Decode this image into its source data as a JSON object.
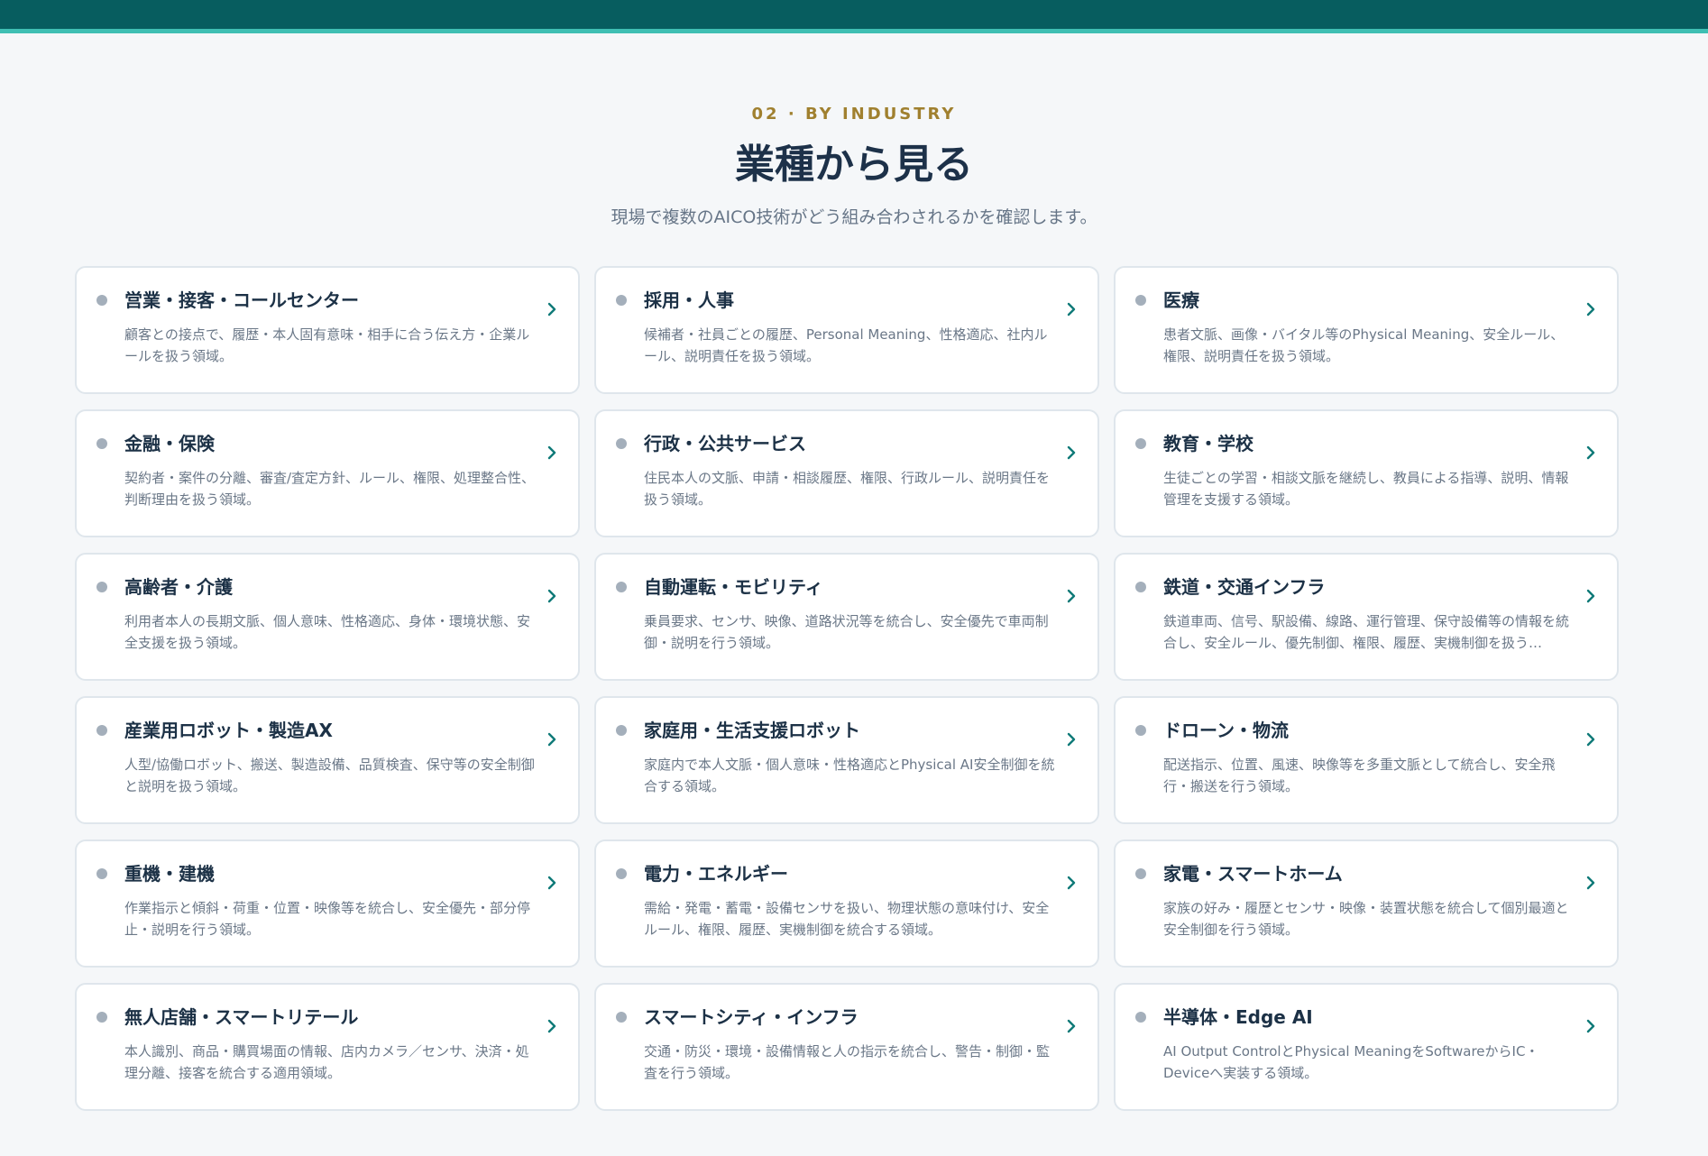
{
  "section": {
    "eyebrow": "02 · BY INDUSTRY",
    "title": "業種から見る",
    "subtitle": "現場で複数のAICO技術がどう組み合わされるかを確認します。"
  },
  "colors": {
    "topbar": "#075d5f",
    "topbar_accent": "#3fbfb3",
    "eyebrow": "#a0802f",
    "chevron": "#0f7a78"
  },
  "cards": [
    {
      "title": "営業・接客・コールセンター",
      "desc": "顧客との接点で、履歴・本人固有意味・相手に合う伝え方・企業ルールを扱う領域。",
      "icon": "chevron-right-icon"
    },
    {
      "title": "採用・人事",
      "desc": "候補者・社員ごとの履歴、Personal Meaning、性格適応、社内ルール、説明責任を扱う領域。",
      "icon": "chevron-right-icon"
    },
    {
      "title": "医療",
      "desc": "患者文脈、画像・バイタル等のPhysical Meaning、安全ルール、権限、説明責任を扱う領域。",
      "icon": "chevron-right-icon"
    },
    {
      "title": "金融・保険",
      "desc": "契約者・案件の分離、審査/査定方針、ルール、権限、処理整合性、判断理由を扱う領域。",
      "icon": "chevron-right-icon"
    },
    {
      "title": "行政・公共サービス",
      "desc": "住民本人の文脈、申請・相談履歴、権限、行政ルール、説明責任を扱う領域。",
      "icon": "chevron-right-icon"
    },
    {
      "title": "教育・学校",
      "desc": "生徒ごとの学習・相談文脈を継続し、教員による指導、説明、情報管理を支援する領域。",
      "icon": "chevron-right-icon"
    },
    {
      "title": "高齢者・介護",
      "desc": "利用者本人の長期文脈、個人意味、性格適応、身体・環境状態、安全支援を扱う領域。",
      "icon": "chevron-right-icon"
    },
    {
      "title": "自動運転・モビリティ",
      "desc": "乗員要求、センサ、映像、道路状況等を統合し、安全優先で車両制御・説明を行う領域。",
      "icon": "chevron-right-icon"
    },
    {
      "title": "鉄道・交通インフラ",
      "desc": "鉄道車両、信号、駅設備、線路、運行管理、保守設備等の情報を統合し、安全ルール、優先制御、権限、履歴、実機制御を扱う…",
      "icon": "chevron-right-icon"
    },
    {
      "title": "産業用ロボット・製造AX",
      "desc": "人型/協働ロボット、搬送、製造設備、品質検査、保守等の安全制御と説明を扱う領域。",
      "icon": "chevron-right-icon"
    },
    {
      "title": "家庭用・生活支援ロボット",
      "desc": "家庭内で本人文脈・個人意味・性格適応とPhysical AI安全制御を統合する領域。",
      "icon": "chevron-right-icon"
    },
    {
      "title": "ドローン・物流",
      "desc": "配送指示、位置、風速、映像等を多重文脈として統合し、安全飛行・搬送を行う領域。",
      "icon": "chevron-right-icon"
    },
    {
      "title": "重機・建機",
      "desc": "作業指示と傾斜・荷重・位置・映像等を統合し、安全優先・部分停止・説明を行う領域。",
      "icon": "chevron-right-icon"
    },
    {
      "title": "電力・エネルギー",
      "desc": "需給・発電・蓄電・設備センサを扱い、物理状態の意味付け、安全ルール、権限、履歴、実機制御を統合する領域。",
      "icon": "chevron-right-icon"
    },
    {
      "title": "家電・スマートホーム",
      "desc": "家族の好み・履歴とセンサ・映像・装置状態を統合して個別最適と安全制御を行う領域。",
      "icon": "chevron-right-icon"
    },
    {
      "title": "無人店舗・スマートリテール",
      "desc": "本人識別、商品・購買場面の情報、店内カメラ／センサ、決済・処理分離、接客を統合する適用領域。",
      "icon": "chevron-right-icon"
    },
    {
      "title": "スマートシティ・インフラ",
      "desc": "交通・防災・環境・設備情報と人の指示を統合し、警告・制御・監査を行う領域。",
      "icon": "chevron-right-icon"
    },
    {
      "title": "半導体・Edge AI",
      "desc": "AI Output ControlとPhysical MeaningをSoftwareからIC・Deviceへ実装する領域。",
      "icon": "chevron-right-icon"
    }
  ]
}
